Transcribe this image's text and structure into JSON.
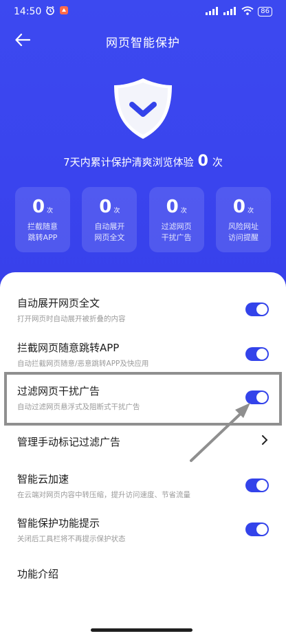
{
  "status_bar": {
    "time": "14:50",
    "battery": "86"
  },
  "header": {
    "title": "网页智能保护"
  },
  "summary": {
    "prefix": "7天内累计保护清爽浏览体验",
    "count": "0",
    "suffix": "次"
  },
  "stats": [
    {
      "value": "0",
      "unit": "次",
      "label_line1": "拦截随意",
      "label_line2": "跳转APP"
    },
    {
      "value": "0",
      "unit": "次",
      "label_line1": "自动展开",
      "label_line2": "网页全文"
    },
    {
      "value": "0",
      "unit": "次",
      "label_line1": "过滤网页",
      "label_line2": "干扰广告"
    },
    {
      "value": "0",
      "unit": "次",
      "label_line1": "风险网址",
      "label_line2": "访问提醒"
    }
  ],
  "settings": [
    {
      "title": "自动展开网页全文",
      "desc": "打开网页时自动展开被折叠的内容",
      "enabled": true
    },
    {
      "title": "拦截网页随意跳转APP",
      "desc": "自动拦截网页随意/恶意跳转APP及快应用",
      "enabled": true
    },
    {
      "title": "过滤网页干扰广告",
      "desc": "自动过滤网页悬浮式及阻断式干扰广告",
      "enabled": true
    },
    {
      "title": "管理手动标记过滤广告"
    },
    {
      "title": "智能云加速",
      "desc": "在云端对网页内容中转压缩，提升访问速度、节省流量",
      "enabled": true
    },
    {
      "title": "智能保护功能提示",
      "desc": "关闭后工具栏将不再提示保护状态",
      "enabled": true
    },
    {
      "title": "功能介绍"
    }
  ],
  "colors": {
    "primary": "#3c49f0",
    "toggle_on": "#3343ea"
  },
  "icons": {
    "back": "back-arrow-icon",
    "shield": "shield-check-icon",
    "chevron": "chevron-right-icon"
  }
}
